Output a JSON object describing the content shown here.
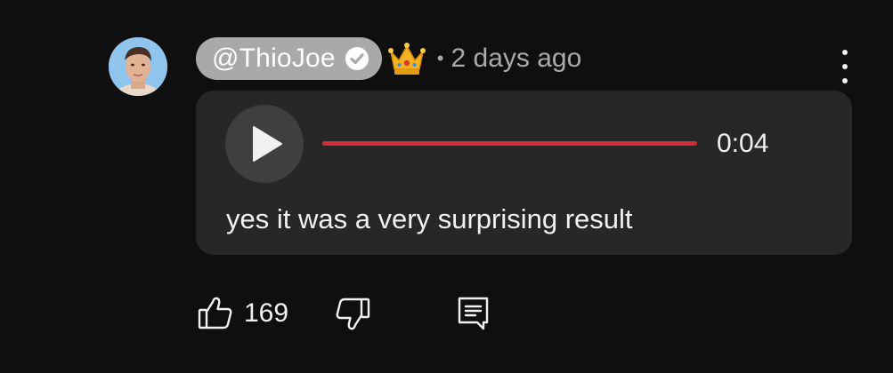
{
  "comment": {
    "author": "@ThioJoe",
    "timestamp": "2 days ago",
    "separator": "•",
    "text": "yes it was a very surprising result",
    "icons": {
      "avatar": "user-avatar",
      "verified": "verified-check-icon",
      "badge": "crown-icon",
      "menu": "more-vert-icon"
    }
  },
  "audio": {
    "duration": "0:04",
    "progress": 1.0,
    "accent_color": "#d32b37"
  },
  "actions": {
    "likes": "169",
    "like_icon": "thumbs-up-icon",
    "dislike_icon": "thumbs-down-icon",
    "reply_icon": "reply-comment-icon"
  }
}
